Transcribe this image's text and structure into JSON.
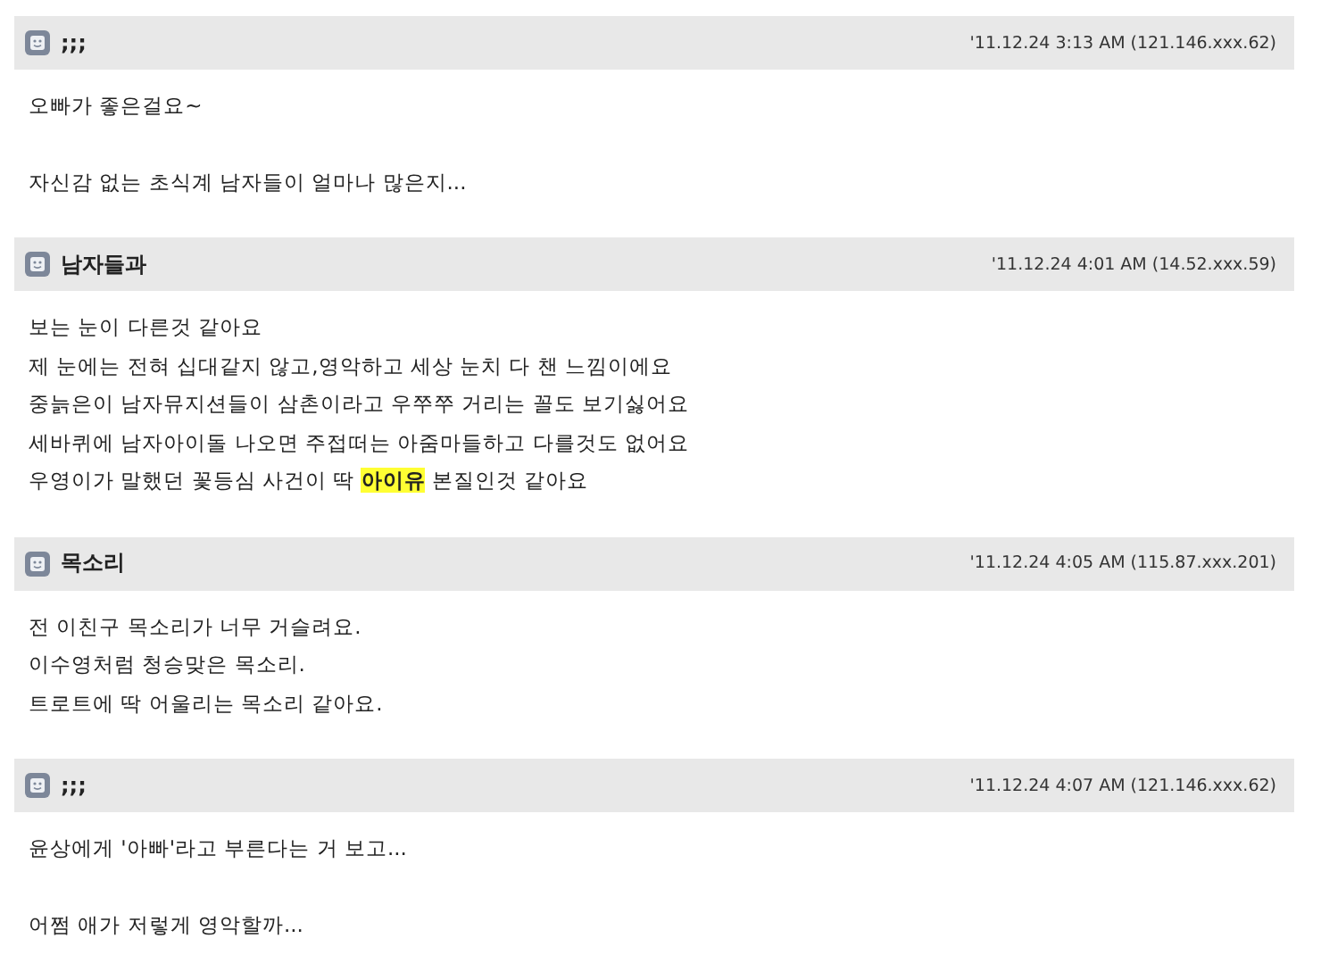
{
  "comments": [
    {
      "author": ";;;",
      "meta": "'11.12.24 3:13 AM (121.146.xxx.62)",
      "paragraphs": [
        [
          "오빠가 좋은걸요~"
        ],
        [
          "자신감 없는 초식계 남자들이 얼마나 많은지..."
        ]
      ]
    },
    {
      "author": "남자들과",
      "meta": "'11.12.24 4:01 AM (14.52.xxx.59)",
      "paragraphs": [
        [
          "보는 눈이 다른것 같아요",
          "제 눈에는 전혀 십대같지 않고,영악하고 세상 눈치 다 챈 느낌이에요",
          "중늙은이 남자뮤지션들이 삼촌이라고 우쭈쭈 거리는 꼴도 보기싫어요",
          "세바퀴에 남자아이돌 나오면 주접떠는 아줌마들하고 다를것도 없어요",
          "우영이가 말했던 꽃등심 사건이 딱 **아이유** 본질인것 같아요"
        ]
      ]
    },
    {
      "author": "목소리",
      "meta": "'11.12.24 4:05 AM (115.87.xxx.201)",
      "paragraphs": [
        [
          "전 이친구 목소리가 너무 거슬려요.",
          "이수영처럼 청승맞은 목소리.",
          "트로트에 딱 어울리는 목소리 같아요."
        ]
      ]
    },
    {
      "author": ";;;",
      "meta": "'11.12.24 4:07 AM (121.146.xxx.62)",
      "paragraphs": [
        [
          "윤상에게 '아빠'라고 부른다는 거 보고..."
        ],
        [
          "어쩜 애가 저렇게 영악할까..."
        ]
      ]
    }
  ]
}
